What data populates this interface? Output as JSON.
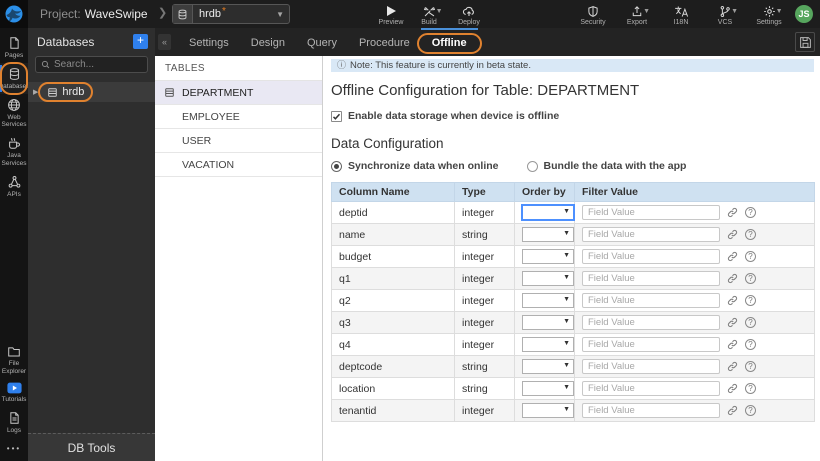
{
  "colors": {
    "accent_blue": "#2f80ed",
    "active_tab_underline": "#4a90d9",
    "annotation_orange": "#e0822f",
    "note_bg": "#d9e8f6",
    "table_header_bg": "#cfe1f1",
    "selected_item_bg": "#e9e8f3",
    "avatar_green": "#57a65e"
  },
  "topbar": {
    "project_label": "Project:",
    "project_name": "WaveSwipe",
    "db_selector_value": "hrdb",
    "db_selector_dirty": "*",
    "left_actions": [
      "Preview",
      "Build",
      "Deploy"
    ],
    "right_actions": [
      "Security",
      "Export",
      "I18N",
      "VCS",
      "Settings"
    ],
    "avatar_initials": "JS"
  },
  "rail": {
    "top_items": [
      {
        "label": "Pages",
        "icon": "page-icon"
      },
      {
        "label": "Databases",
        "icon": "database-icon"
      },
      {
        "label": "Web Services",
        "icon": "globe-icon"
      },
      {
        "label": "Java Services",
        "icon": "coffee-icon"
      },
      {
        "label": "APIs",
        "icon": "api-icon"
      }
    ],
    "bottom_items": [
      {
        "label": "File Explorer",
        "icon": "folder-icon"
      },
      {
        "label": "Tutorials",
        "icon": "play-icon"
      },
      {
        "label": "Logs",
        "icon": "log-icon"
      }
    ],
    "active_item": "Databases",
    "overflow": "•••"
  },
  "db_panel": {
    "title": "Databases",
    "add_button": "+",
    "search_placeholder": "Search...",
    "tree_items": [
      {
        "label": "hrdb"
      }
    ],
    "footer_button": "DB Tools"
  },
  "tabs": {
    "items": [
      "Settings",
      "Design",
      "Query",
      "Procedure",
      "Offline"
    ],
    "active": "Offline"
  },
  "tables_panel": {
    "title": "TABLES",
    "items": [
      "DEPARTMENT",
      "EMPLOYEE",
      "USER",
      "VACATION"
    ],
    "selected": "DEPARTMENT"
  },
  "main": {
    "note_text": "Note: This feature is currently in beta state.",
    "heading": "Offline Configuration for Table: DEPARTMENT",
    "enable_label": "Enable data storage when device is offline",
    "enable_checked": true,
    "section_title": "Data Configuration",
    "radios": [
      {
        "label": "Synchronize data when online",
        "selected": true
      },
      {
        "label": "Bundle the data with the app",
        "selected": false
      }
    ],
    "config_table": {
      "headers": [
        "Column Name",
        "Type",
        "Order by",
        "Filter Value"
      ],
      "filter_placeholder": "Field Value",
      "rows": [
        {
          "name": "deptid",
          "type": "integer"
        },
        {
          "name": "name",
          "type": "string"
        },
        {
          "name": "budget",
          "type": "integer"
        },
        {
          "name": "q1",
          "type": "integer"
        },
        {
          "name": "q2",
          "type": "integer"
        },
        {
          "name": "q3",
          "type": "integer"
        },
        {
          "name": "q4",
          "type": "integer"
        },
        {
          "name": "deptcode",
          "type": "string"
        },
        {
          "name": "location",
          "type": "string"
        },
        {
          "name": "tenantid",
          "type": "integer"
        }
      ]
    }
  }
}
